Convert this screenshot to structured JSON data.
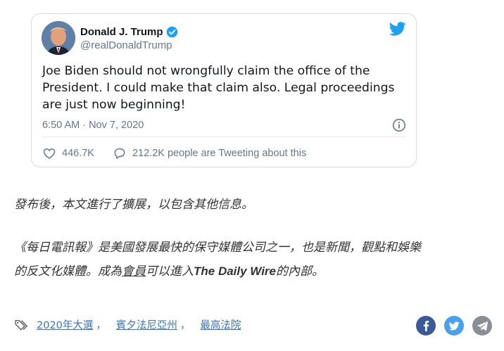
{
  "tweet": {
    "author_name": "Donald J. Trump",
    "handle": "@realDonaldTrump",
    "text": "Joe Biden should not wrongfully claim the office of the President. I could make that claim also. Legal proceedings are just now beginning!",
    "timestamp": "6:50 AM · Nov 7, 2020",
    "likes": "446.7K",
    "retweet_talk": "212.2K people are Tweeting about this",
    "twitter_blue": "#1da1f2"
  },
  "article": {
    "expanded_note": "發布後，本文進行了擴展，以包含其他信息。",
    "promo_part1": "《每日電訊報》是美國發展最快的保守媒體公司之一，也是新聞，觀點和娛樂",
    "promo_part2": "的反文化媒體。成為",
    "promo_link": "會員",
    "promo_part3": "可以進入",
    "promo_brand": "The Daily Wire",
    "promo_part4": "的內部。"
  },
  "tags": [
    "2020年大選",
    "賓夕法尼亞州",
    "最高法院"
  ],
  "tag_separator": "，",
  "share": {
    "facebook_icon": "facebook-icon",
    "twitter_icon": "twitter-icon",
    "telegram_icon": "telegram-icon"
  }
}
